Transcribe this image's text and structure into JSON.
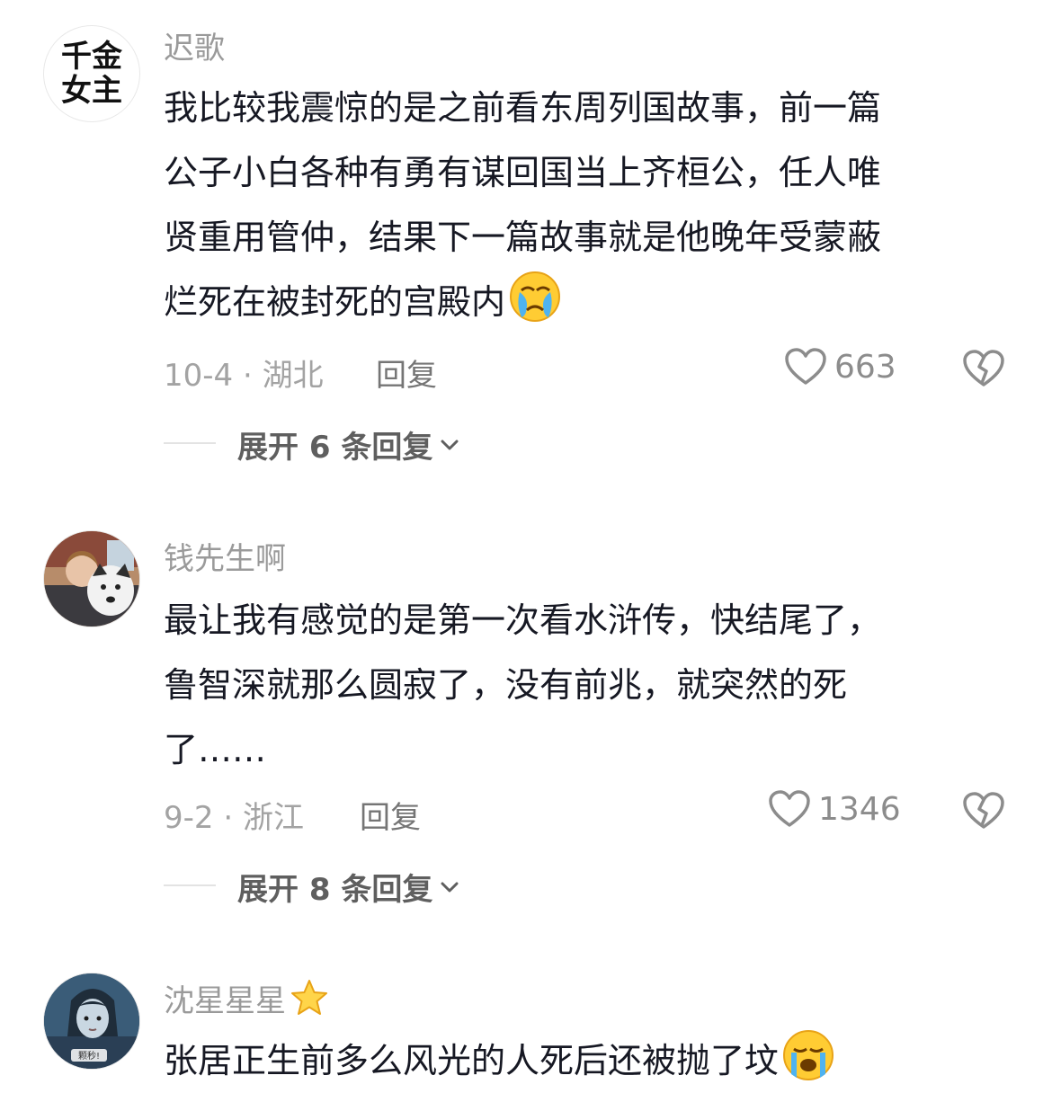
{
  "comments": [
    {
      "avatar_text": [
        "千金",
        "女主"
      ],
      "username": "迟歌",
      "lines": [
        "我比较我震惊的是之前看东周列国故事，前一篇",
        "公子小白各种有勇有谋回国当上齐桓公，任人唯",
        "贤重用管仲，结果下一篇故事就是他晚年受蒙蔽",
        "烂死在被封死的宫殿内"
      ],
      "trailing_emoji": "crying-face-icon",
      "date_location": "10-4 · 湖北",
      "reply_label": "回复",
      "like_count": "663",
      "expand_label": "展开 6 条回复"
    },
    {
      "username": "钱先生啊",
      "lines": [
        "最让我有感觉的是第一次看水浒传，快结尾了，",
        "鲁智深就那么圆寂了，没有前兆，就突然的死",
        "了……"
      ],
      "date_location": "9-2 · 浙江",
      "reply_label": "回复",
      "like_count": "1346",
      "expand_label": "展开 8 条回复"
    },
    {
      "username": "沈星星星",
      "username_badge": "star-icon",
      "lines": [
        "张居正生前多么风光的人死后还被抛了坟"
      ],
      "trailing_emoji": "loudly-crying-face-icon",
      "avatar_caption": "颗秒!"
    }
  ]
}
